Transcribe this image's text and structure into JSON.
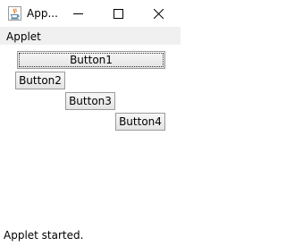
{
  "window": {
    "title": "App...",
    "icon": "java-icon",
    "controls": [
      "minimize-icon",
      "maximize-icon",
      "close-icon"
    ]
  },
  "applet_menu": {
    "label": "Applet"
  },
  "buttons": [
    {
      "label": "Button1",
      "focused": true
    },
    {
      "label": "Button2",
      "focused": false
    },
    {
      "label": "Button3",
      "focused": false
    },
    {
      "label": "Button4",
      "focused": false
    }
  ],
  "status": {
    "text": "Applet started."
  },
  "colors": {
    "menubar_bg": "#f0f0f0",
    "button_border": "#9a9a9a",
    "java_cup_red": "#e76f00",
    "java_cup_blue": "#5382a1"
  }
}
